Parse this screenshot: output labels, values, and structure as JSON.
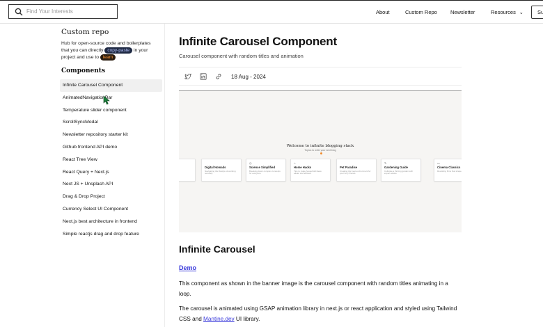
{
  "header": {
    "search_placeholder": "Find Your Interests",
    "nav": {
      "about": "About",
      "custom_repo": "Custom Repo",
      "newsletter": "Newsletter",
      "resources": "Resources",
      "subscribe": "Su"
    }
  },
  "sidebar": {
    "title": "Custom repo",
    "desc_before": "Hub for open-source code and boilerplates that you can directly ",
    "chip_copy": "copy-paste",
    "desc_middle": " in your project and use to ",
    "chip_learn": "learn",
    "components_heading": "Components",
    "items": [
      "Infinite Carousel Component",
      "AnimatedNavigationBar",
      "Temperature slider component",
      "ScrollSyncModal",
      "Newsletter repository starter kit",
      "Github frontend API demo",
      "React Tree View",
      "React Query + Next.js",
      "Next JS + Unsplash API",
      "Drag & Drop Project",
      "Currency Select UI Component",
      "Next.js best architecture in frontend",
      "Simple reactjs drag and drop feature"
    ],
    "active_index": 0
  },
  "article": {
    "title": "Infinite Carousel Component",
    "subtitle": "Carousel component with random titles and animation",
    "date": "18 Aug - 2024",
    "banner": {
      "heading": "Welcome to infinite blogging stack",
      "subheading": "Topics to write your next blog",
      "cards": [
        {
          "icon": "",
          "title": "ard",
          "desc": "nation data"
        },
        {
          "icon": "",
          "title": "Digital Nomads",
          "desc": "Navigating the lifestyle of working remotely"
        },
        {
          "icon": "◷",
          "title": "Science Simplified",
          "desc": "Breaking down complex concepts for everyone"
        },
        {
          "icon": "⌂",
          "title": "Home Hacks",
          "desc": "Tips to make household ideas easier and efficient"
        },
        {
          "icon": "",
          "title": "Pet Paradise",
          "desc": "Creating the best environment for your furry friends"
        },
        {
          "icon": "✎",
          "title": "Gardening Guide",
          "desc": "Cultivate a thriving garden with expert advice"
        },
        {
          "icon": "▭",
          "title": "Cinema Classics",
          "desc": "Revisiting films that shaped cinema"
        }
      ]
    },
    "section_heading": "Infinite Carousel",
    "demo_link": "Demo",
    "para1": "This component as shown in the banner image is the carousel component with random titles animating in a loop.",
    "para2_before": "The carousel is animated using GSAP animation library in next.js or react application and styled using Tailwind CSS and ",
    "para2_link": "Mantine.dev",
    "para2_after": " UI library."
  },
  "colors": {
    "link": "#3b3bdb",
    "chip_blue_bg": "#1f2a44",
    "chip_orange_text": "#ff9b3d",
    "cursor": "#1a7f3a"
  },
  "icons": [
    "search-icon",
    "twitter-icon",
    "linkedin-icon",
    "link-icon",
    "chevron-down-icon",
    "mouse-cursor-icon"
  ]
}
